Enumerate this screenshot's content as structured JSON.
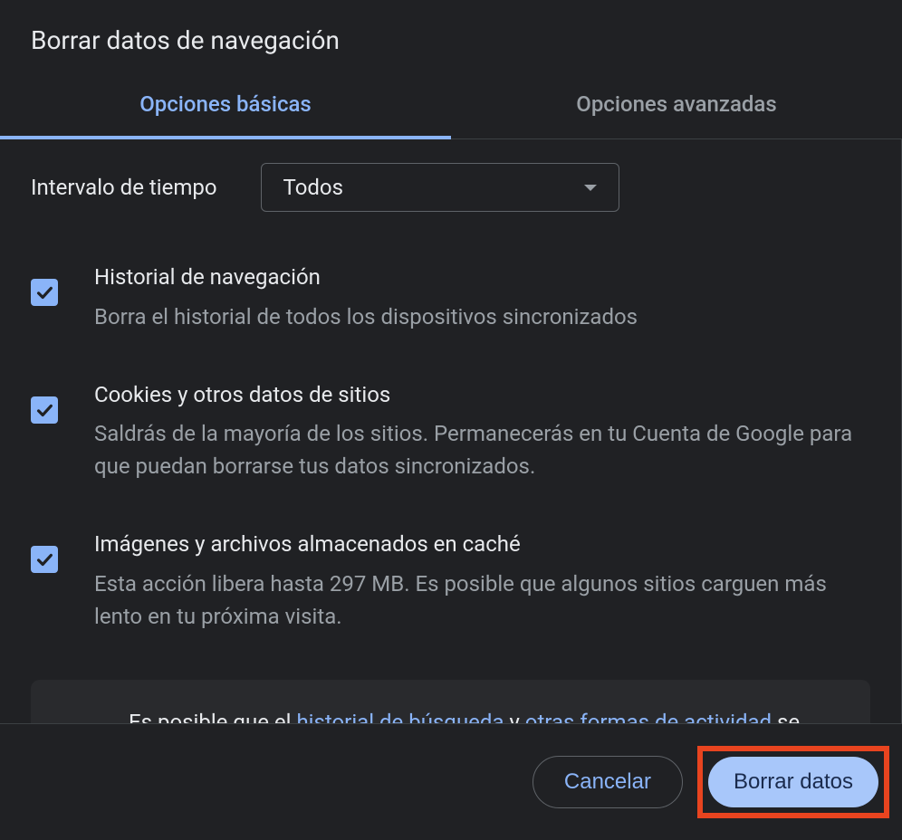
{
  "dialog": {
    "title": "Borrar datos de navegación"
  },
  "tabs": {
    "basic": "Opciones básicas",
    "advanced": "Opciones avanzadas"
  },
  "time": {
    "label": "Intervalo de tiempo",
    "value": "Todos"
  },
  "options": [
    {
      "title": "Historial de navegación",
      "desc": "Borra el historial de todos los dispositivos sincronizados",
      "checked": true
    },
    {
      "title": "Cookies y otros datos de sitios",
      "desc": "Saldrás de la mayoría de los sitios. Permanecerás en tu Cuenta de Google para que puedan borrarse tus datos sincronizados.",
      "checked": true
    },
    {
      "title": "Imágenes y archivos almacenados en caché",
      "desc": "Esta acción libera hasta 297 MB. Es posible que algunos sitios carguen más lento en tu próxima visita.",
      "checked": true
    }
  ],
  "info": {
    "pre": "Es posible que el ",
    "link1": "historial de búsqueda",
    "mid": " y ",
    "link2": "otras formas de actividad",
    "post": " se guarden en tu Cuenta de Google cuando accedes. Podrás"
  },
  "footer": {
    "cancel": "Cancelar",
    "clear": "Borrar datos"
  }
}
